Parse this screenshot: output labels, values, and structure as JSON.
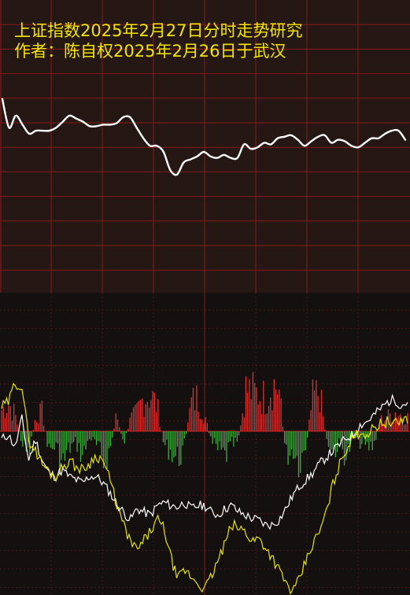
{
  "title": "上证指数2025年2月27日分时走势研究",
  "subtitle": "作者：陈自权2025年2月26日于武汉",
  "colors": {
    "top_bg": "#241714",
    "bottom_bg": "#141010",
    "grid_top": "#8b1a1a",
    "grid_bottom_dashed": "#4a1616",
    "grid_bottom_solid": "#8b1a1a",
    "text": "#f2e600",
    "price_line": "#ffffff",
    "white_line": "#ffffff",
    "yellow_line": "#e6e600",
    "bar_up": "#e03030",
    "bar_down": "#3fae3f"
  },
  "chart_data": [
    {
      "type": "line",
      "title": "",
      "grid": true,
      "xlim": [
        0,
        240
      ],
      "ylim": [
        0,
        100
      ],
      "series": [
        {
          "x": [
            0,
            4,
            8,
            12,
            16,
            20,
            24,
            28,
            32,
            36,
            40,
            44,
            48,
            52,
            56,
            60,
            64,
            68,
            72,
            76,
            80,
            84,
            88,
            92,
            96,
            100,
            104,
            108,
            112,
            116,
            120,
            124,
            128,
            132,
            136,
            140,
            144,
            148,
            152,
            156,
            160,
            164,
            168,
            172,
            176,
            180,
            184,
            188,
            192,
            196,
            200,
            204,
            208,
            212,
            216,
            220,
            224,
            228,
            232,
            236,
            240
          ],
          "values": [
            97,
            78,
            86,
            80,
            74,
            76,
            76,
            76,
            78,
            82,
            86,
            84,
            82,
            79,
            79,
            80,
            80,
            81,
            85,
            85,
            78,
            71,
            66,
            66,
            62,
            50,
            47,
            55,
            57,
            59,
            62,
            59,
            58,
            60,
            58,
            58,
            67,
            64,
            65,
            68,
            67,
            71,
            72,
            73,
            70,
            66,
            69,
            72,
            73,
            68,
            70,
            69,
            66,
            65,
            68,
            71,
            71,
            74,
            76,
            76,
            70
          ]
        }
      ]
    },
    {
      "type": "line",
      "title": "",
      "grid": true,
      "xlim": [
        0,
        240
      ],
      "ylim": [
        -100,
        100
      ],
      "series": [
        {
          "x": [
            0,
            4,
            8,
            12,
            16,
            20,
            24,
            28,
            32,
            36,
            40,
            44,
            48,
            52,
            56,
            60,
            64,
            68,
            72,
            76,
            80,
            84,
            88,
            92,
            96,
            100,
            104,
            108,
            112,
            116,
            120,
            124,
            128,
            132,
            136,
            140,
            144,
            148,
            152,
            156,
            160,
            164,
            168,
            172,
            176,
            180,
            184,
            188,
            192,
            196,
            200,
            204,
            208,
            212,
            216,
            220,
            224,
            228,
            232,
            236,
            240
          ],
          "values": [
            -5,
            -2,
            -10,
            8,
            -18,
            -5,
            -18,
            -26,
            -28,
            -24,
            -28,
            -30,
            -32,
            -28,
            -28,
            -32,
            -38,
            -45,
            -50,
            -55,
            -48,
            -50,
            -52,
            -46,
            -44,
            -46,
            -47,
            -44,
            -48,
            -46,
            -46,
            -50,
            -52,
            -48,
            -46,
            -50,
            -52,
            -54,
            -55,
            -58,
            -58,
            -55,
            -48,
            -40,
            -34,
            -30,
            -26,
            -20,
            -16,
            -12,
            -8,
            -4,
            -2,
            4,
            6,
            10,
            14,
            18,
            20,
            16,
            18
          ]
        },
        {
          "x": [
            0,
            4,
            8,
            12,
            16,
            20,
            24,
            28,
            32,
            36,
            40,
            44,
            48,
            52,
            56,
            60,
            64,
            68,
            72,
            76,
            80,
            84,
            88,
            92,
            96,
            100,
            104,
            108,
            112,
            116,
            120,
            124,
            128,
            132,
            136,
            140,
            144,
            148,
            152,
            156,
            160,
            164,
            168,
            172,
            176,
            180,
            184,
            188,
            192,
            196,
            200,
            204,
            208,
            212,
            216,
            220,
            224,
            228,
            232,
            236,
            240
          ],
          "values": [
            15,
            18,
            30,
            28,
            -5,
            -12,
            -20,
            -25,
            -28,
            -22,
            -18,
            -22,
            -24,
            -20,
            -15,
            -18,
            -30,
            -45,
            -58,
            -68,
            -74,
            -68,
            -62,
            -55,
            -60,
            -78,
            -92,
            -86,
            -90,
            -94,
            -98,
            -90,
            -80,
            -70,
            -58,
            -60,
            -62,
            -68,
            -66,
            -72,
            -78,
            -86,
            -94,
            -100,
            -92,
            -80,
            -70,
            -62,
            -50,
            -32,
            -20,
            -10,
            -4,
            0,
            -2,
            2,
            5,
            6,
            4,
            7,
            8
          ]
        },
        {
          "x": [
            0,
            4,
            8,
            12,
            16,
            20,
            24,
            28,
            32,
            36,
            40,
            44,
            48,
            52,
            56,
            60,
            64,
            68,
            72,
            76,
            80,
            84,
            88,
            92,
            96,
            100,
            104,
            108,
            112,
            116,
            120,
            124,
            128,
            132,
            136,
            140,
            144,
            148,
            152,
            156,
            160,
            164,
            168,
            172,
            176,
            180,
            184,
            188,
            192,
            196,
            200,
            204,
            208,
            212,
            216,
            220,
            224,
            228,
            232,
            236,
            240
          ],
          "values": [
            15,
            20,
            12,
            -8,
            -18,
            10,
            14,
            -14,
            -10,
            -24,
            -12,
            -8,
            -18,
            -4,
            -10,
            -22,
            -14,
            12,
            -10,
            8,
            14,
            24,
            26,
            18,
            -10,
            -14,
            -20,
            -12,
            20,
            24,
            12,
            -8,
            -14,
            -18,
            -10,
            -8,
            30,
            28,
            26,
            24,
            34,
            30,
            -18,
            -12,
            -22,
            -10,
            24,
            28,
            -6,
            -14,
            -10,
            -18,
            -4,
            -8,
            -12,
            -10,
            8,
            10,
            14,
            12,
            10
          ]
        }
      ]
    }
  ]
}
